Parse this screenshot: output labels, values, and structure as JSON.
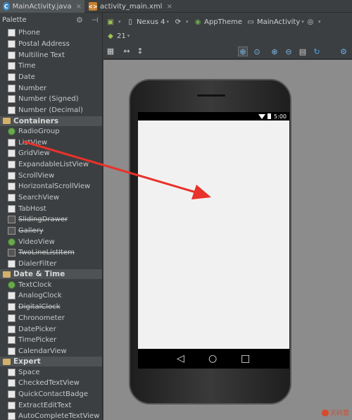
{
  "tabs": [
    {
      "label": "MainActivity.java",
      "type": "java"
    },
    {
      "label": "activity_main.xml",
      "type": "xml"
    }
  ],
  "palette": {
    "title": "Palette",
    "sections": [
      {
        "category": "",
        "items": [
          {
            "label": "Phone",
            "strike": false
          },
          {
            "label": "Postal Address",
            "strike": false
          },
          {
            "label": "Multiline Text",
            "strike": false
          },
          {
            "label": "Time",
            "strike": false
          },
          {
            "label": "Date",
            "strike": false
          },
          {
            "label": "Number",
            "strike": false
          },
          {
            "label": "Number (Signed)",
            "strike": false
          },
          {
            "label": "Number (Decimal)",
            "strike": false
          }
        ]
      },
      {
        "category": "Containers",
        "items": [
          {
            "label": "RadioGroup",
            "strike": false
          },
          {
            "label": "ListView",
            "strike": false
          },
          {
            "label": "GridView",
            "strike": false
          },
          {
            "label": "ExpandableListView",
            "strike": false
          },
          {
            "label": "ScrollView",
            "strike": false
          },
          {
            "label": "HorizontalScrollView",
            "strike": false
          },
          {
            "label": "SearchView",
            "strike": false
          },
          {
            "label": "TabHost",
            "strike": false
          },
          {
            "label": "SlidingDrawer",
            "strike": true
          },
          {
            "label": "Gallery",
            "strike": true
          },
          {
            "label": "VideoView",
            "strike": false
          },
          {
            "label": "TwoLineListItem",
            "strike": true
          },
          {
            "label": "DialerFilter",
            "strike": false
          }
        ]
      },
      {
        "category": "Date & Time",
        "items": [
          {
            "label": "TextClock",
            "strike": false
          },
          {
            "label": "AnalogClock",
            "strike": false
          },
          {
            "label": "DigitalClock",
            "strike": true
          },
          {
            "label": "Chronometer",
            "strike": false
          },
          {
            "label": "DatePicker",
            "strike": false
          },
          {
            "label": "TimePicker",
            "strike": false
          },
          {
            "label": "CalendarView",
            "strike": false
          }
        ]
      },
      {
        "category": "Expert",
        "items": [
          {
            "label": "Space",
            "strike": false
          },
          {
            "label": "CheckedTextView",
            "strike": false
          },
          {
            "label": "QuickContactBadge",
            "strike": false
          },
          {
            "label": "ExtractEditText",
            "strike": false
          },
          {
            "label": "AutoCompleteTextView",
            "strike": false
          }
        ]
      }
    ]
  },
  "toolbar": {
    "device": "Nexus 4",
    "theme": "AppTheme",
    "activity": "MainActivity",
    "api_level": "21"
  },
  "device_preview": {
    "clock": "5:00"
  },
  "watermark": "天码营",
  "colors": {
    "arrow": "#e8322b",
    "content_bg": "#f2f1f1",
    "canvas_bg": "#8c8c8c"
  }
}
